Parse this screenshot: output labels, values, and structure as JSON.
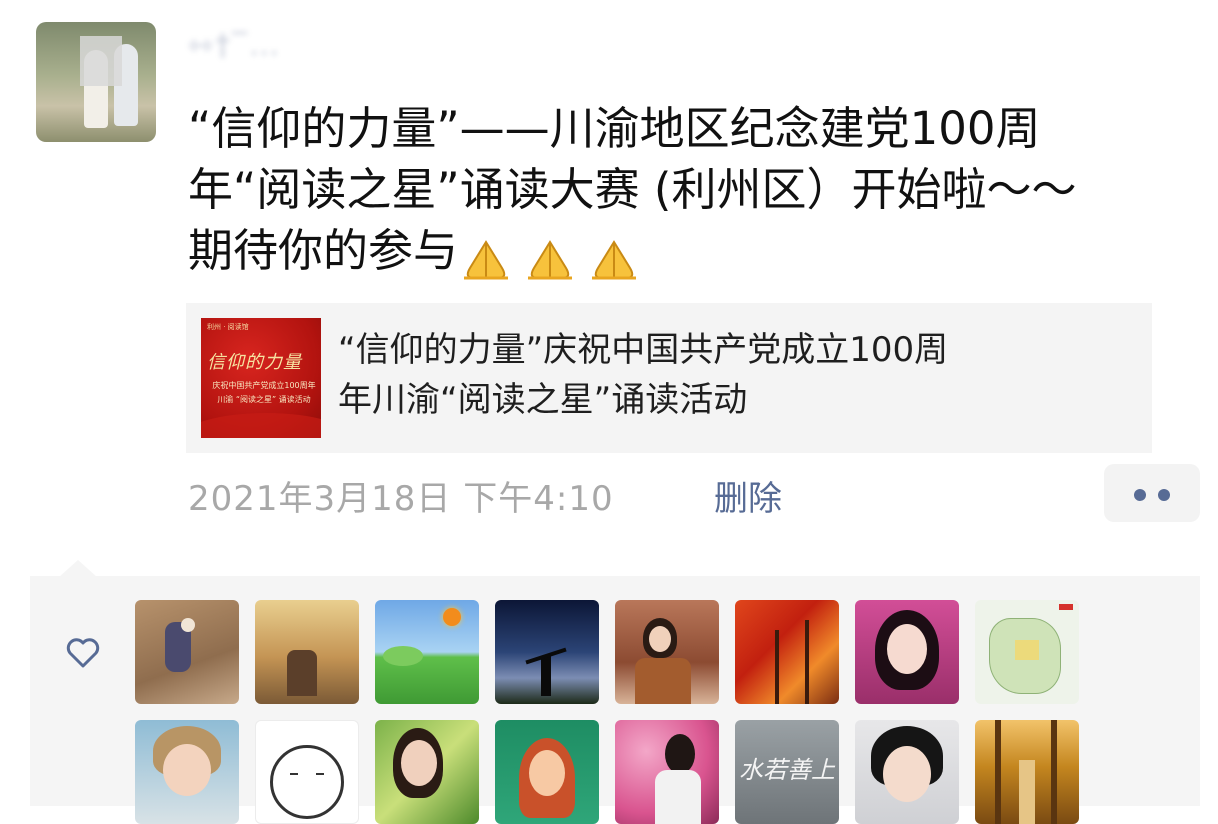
{
  "post": {
    "author": {
      "name": "⇿†‾…"
    },
    "text_line1": "“信仰的力量”——川渝地区纪念建党100周",
    "text_line2": "年“阅读之星”诵读大赛 (利州区）开始啦～～",
    "text_line3": "期待你的参与",
    "emoji_icons": [
      "folded-hands-icon",
      "folded-hands-icon",
      "folded-hands-icon"
    ]
  },
  "link_card": {
    "title_line1": "“信仰的力量”庆祝中国共产党成立100周",
    "title_line2": "年川渝“阅读之星”诵读活动",
    "thumbnail": {
      "top_caption": "利州 · 阅读馆",
      "title": "信仰的力量",
      "subtitle1": "庆祝中国共产党成立100周年",
      "subtitle2": "川渝 “阅读之星” 诵读活动"
    }
  },
  "meta": {
    "timestamp": "2021年3月18日 下午4:10",
    "delete_label": "删除",
    "more_icon": "more-dots-icon"
  },
  "likes": {
    "icon": "heart-outline-icon",
    "avatars": [
      "avatar-autumn-leaves",
      "avatar-hotel-lobby",
      "avatar-sunny-meadow",
      "avatar-starry-sky",
      "avatar-woman-tea",
      "avatar-red-trees",
      "avatar-woman-portrait",
      "avatar-map",
      "avatar-woman-short-hair",
      "avatar-cartoon-girl",
      "avatar-woman-green-leaves",
      "avatar-illustrated-girl",
      "avatar-woman-pink-flowers",
      "avatar-stone-calligraphy",
      "avatar-woman-bob",
      "avatar-forest-path"
    ],
    "stone_text": "水若善上"
  },
  "colors": {
    "link_blue": "#576b95",
    "timestamp_gray": "#a8a8a8",
    "panel_bg": "#f5f5f5"
  }
}
